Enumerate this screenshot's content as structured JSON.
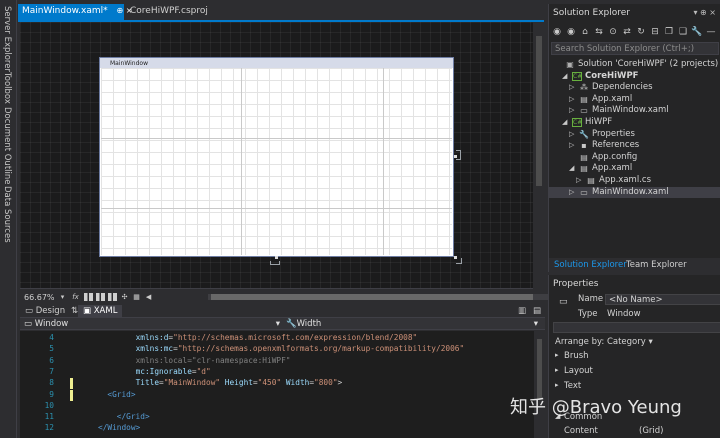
{
  "left_strip": [
    "Server Explorer",
    "Toolbox",
    "Document Outline",
    "Data Sources"
  ],
  "tabs": [
    {
      "label": "MainWindow.xaml*",
      "active": true
    },
    {
      "label": "CoreHiWPF.csproj",
      "active": false
    }
  ],
  "tab_icons": {
    "pin": "⊕",
    "close": "×"
  },
  "designer": {
    "window_title": "MainWindow",
    "zoom": "66.67%",
    "fx": "fx"
  },
  "view_tabs": {
    "design": "Design",
    "xaml": "XAML"
  },
  "element_bar": {
    "element": "Window",
    "member": "Width"
  },
  "code_lines": [
    {
      "num": "4",
      "parts": [
        [
          "attr",
          "xmlns:d"
        ],
        [
          "text",
          "="
        ],
        [
          "val",
          "\"http://schemas.microsoft.com/expression/blend/2008\""
        ]
      ],
      "indent": "        "
    },
    {
      "num": "5",
      "parts": [
        [
          "attr",
          "xmlns:mc"
        ],
        [
          "text",
          "="
        ],
        [
          "val",
          "\"http://schemas.openxmlformats.org/markup-compatibility/2006\""
        ]
      ],
      "indent": "        "
    },
    {
      "num": "6",
      "parts": [
        [
          "gray",
          "xmlns:local"
        ],
        [
          "gray",
          "=\"clr-namespace:HiWPF\""
        ]
      ],
      "indent": "        "
    },
    {
      "num": "7",
      "parts": [
        [
          "attr",
          "mc:Ignorable"
        ],
        [
          "text",
          "="
        ],
        [
          "val",
          "\"d\""
        ]
      ],
      "indent": "        "
    },
    {
      "num": "8",
      "parts": [
        [
          "attr",
          "Title"
        ],
        [
          "text",
          "="
        ],
        [
          "val",
          "\"MainWindow\""
        ],
        [
          "text",
          " "
        ],
        [
          "attr",
          "Height"
        ],
        [
          "text",
          "="
        ],
        [
          "val",
          "\"450\""
        ],
        [
          "text",
          " "
        ],
        [
          "attr",
          "Width"
        ],
        [
          "text",
          "="
        ],
        [
          "val",
          "\"800\""
        ],
        [
          "text",
          ">"
        ]
      ],
      "indent": "        "
    },
    {
      "num": "9",
      "parts": [
        [
          "tag",
          "<Grid>"
        ]
      ],
      "indent": "  "
    },
    {
      "num": "10",
      "parts": [],
      "indent": ""
    },
    {
      "num": "11",
      "parts": [
        [
          "tag",
          "</Grid>"
        ]
      ],
      "indent": "    "
    },
    {
      "num": "12",
      "parts": [
        [
          "tag",
          "</Window>"
        ]
      ],
      "indent": ""
    }
  ],
  "solution_explorer": {
    "title": "Solution Explorer",
    "title_icons": "▾ ⊕ ×",
    "search_placeholder": "Search Solution Explorer (Ctrl+;)",
    "tree": [
      {
        "label": "Solution 'CoreHiWPF' (2 projects)",
        "level": 0,
        "arrow": "",
        "icon": "▣",
        "iconcolor": "#b0b0b0",
        "bold": false
      },
      {
        "label": "CoreHiWPF",
        "level": 1,
        "arrow": "◢",
        "icon": "C#",
        "iconcolor": "#68b03f",
        "bold": true
      },
      {
        "label": "Dependencies",
        "level": 2,
        "arrow": "▷",
        "icon": "⁂",
        "iconcolor": "#c8c8c8",
        "bold": false
      },
      {
        "label": "App.xaml",
        "level": 2,
        "arrow": "▷",
        "icon": "▤",
        "iconcolor": "#c8c8c8",
        "bold": false
      },
      {
        "label": "MainWindow.xaml",
        "level": 2,
        "arrow": "▷",
        "icon": "▭",
        "iconcolor": "#c8c8c8",
        "bold": false
      },
      {
        "label": "HiWPF",
        "level": 1,
        "arrow": "◢",
        "icon": "C#",
        "iconcolor": "#68b03f",
        "bold": false
      },
      {
        "label": "Properties",
        "level": 2,
        "arrow": "▷",
        "icon": "🔧",
        "iconcolor": "#c8c8c8",
        "bold": false
      },
      {
        "label": "References",
        "level": 2,
        "arrow": "▷",
        "icon": "▪",
        "iconcolor": "#c8c8c8",
        "bold": false
      },
      {
        "label": "App.config",
        "level": 2,
        "arrow": "",
        "icon": "▤",
        "iconcolor": "#c8c8c8",
        "bold": false
      },
      {
        "label": "App.xaml",
        "level": 2,
        "arrow": "◢",
        "icon": "▤",
        "iconcolor": "#c8c8c8",
        "bold": false
      },
      {
        "label": "App.xaml.cs",
        "level": 3,
        "arrow": "▷",
        "icon": "▤",
        "iconcolor": "#c8c8c8",
        "bold": false
      },
      {
        "label": "MainWindow.xaml",
        "level": 2,
        "arrow": "▷",
        "icon": "▭",
        "iconcolor": "#c8c8c8",
        "bold": false,
        "selected": true
      }
    ],
    "bottom_tabs": [
      "Solution Explorer",
      "Team Explorer"
    ]
  },
  "properties": {
    "title": "Properties",
    "name_label": "Name",
    "name_value": "<No Name>",
    "type_label": "Type",
    "type_value": "Window",
    "arrange_by": "Arrange by: Category ▾",
    "categories": [
      "Brush",
      "Layout",
      "Text",
      "Common"
    ],
    "content_label": "Content",
    "content_value": "(Grid)"
  },
  "watermark": "知乎 @Bravo Yeung",
  "colors": {
    "accent": "#007acc",
    "background": "#2d2d30",
    "editor": "#1e1e1e"
  }
}
